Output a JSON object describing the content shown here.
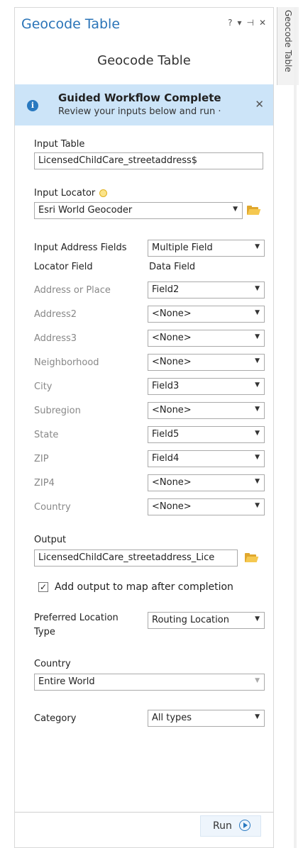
{
  "pane": {
    "title": "Geocode Table",
    "controls": {
      "help": "?",
      "menu": "▾",
      "pin": "⊣",
      "close": "✕"
    },
    "side_tab": "Geocode Table"
  },
  "tool": {
    "subtitle": "Geocode Table",
    "banner": {
      "icon": "i",
      "title": "Guided Workflow Complete",
      "text": "Review your inputs below and run ·",
      "close": "✕"
    }
  },
  "form": {
    "input_table": {
      "label": "Input Table",
      "value": "LicensedChildCare_streetaddress$"
    },
    "input_locator": {
      "label": "Input Locator",
      "value": "Esri World Geocoder"
    },
    "address_fields": {
      "label": "Input Address Fields",
      "value": "Multiple Field"
    },
    "mapping_headers": {
      "locator": "Locator Field",
      "data": "Data Field"
    },
    "mappings": [
      {
        "field": "Address or Place",
        "value": "Field2"
      },
      {
        "field": "Address2",
        "value": "<None>"
      },
      {
        "field": "Address3",
        "value": "<None>"
      },
      {
        "field": "Neighborhood",
        "value": "<None>"
      },
      {
        "field": "City",
        "value": "Field3"
      },
      {
        "field": "Subregion",
        "value": "<None>"
      },
      {
        "field": "State",
        "value": "Field5"
      },
      {
        "field": "ZIP",
        "value": "Field4"
      },
      {
        "field": "ZIP4",
        "value": "<None>"
      },
      {
        "field": "Country",
        "value": "<None>"
      }
    ],
    "output": {
      "label": "Output",
      "value": "LicensedChildCare_streetaddress_Licе"
    },
    "add_output": {
      "label": "Add output to map after completion",
      "checked": "✓"
    },
    "preferred_location": {
      "label_line1": "Preferred Location",
      "label_line2": "Type",
      "value": "Routing Location"
    },
    "country": {
      "label": "Country",
      "value": "Entire World"
    },
    "category": {
      "label": "Category",
      "value": "All types"
    }
  },
  "footer": {
    "run_label": "Run"
  },
  "colors": {
    "accent": "#2a74b8",
    "banner_bg": "#cce4f8",
    "folder": "#e0a72d"
  }
}
